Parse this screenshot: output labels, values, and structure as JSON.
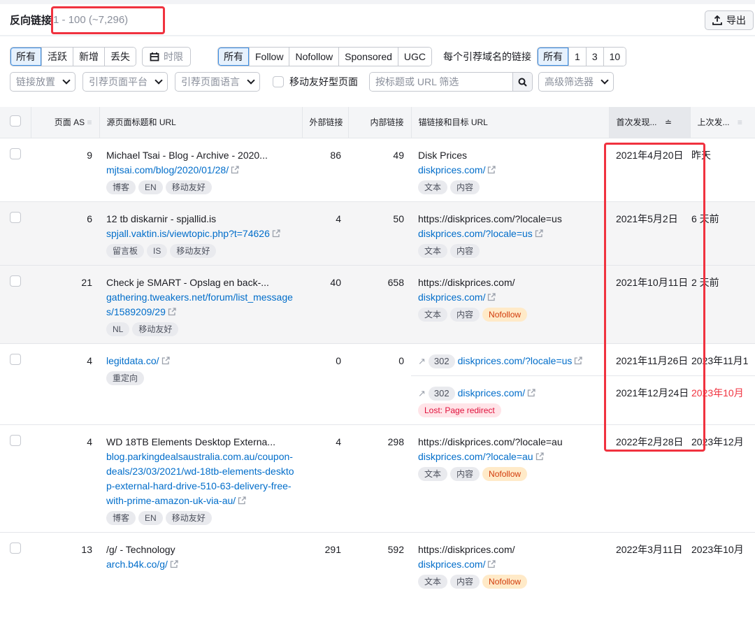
{
  "header": {
    "title": "反向链接",
    "count": "1 - 100 (~7,296)",
    "export_label": "导出",
    "export_icon": "upload-icon"
  },
  "filters": {
    "status_options": [
      "所有",
      "活跃",
      "新增",
      "丢失"
    ],
    "status_selected": "所有",
    "period_label": "时限",
    "period_icon": "calendar-icon",
    "type_options": [
      "所有",
      "Follow",
      "Nofollow",
      "Sponsored",
      "UGC"
    ],
    "type_selected": "所有",
    "per_domain_label": "每个引荐域名的链接",
    "per_domain_options": [
      "所有",
      "1",
      "3",
      "10"
    ],
    "per_domain_selected": "所有",
    "dropdowns": [
      "链接放置",
      "引荐页面平台",
      "引荐页面语言"
    ],
    "mobile_friendly_label": "移动友好型页面",
    "search_placeholder": "按标题或 URL 筛选",
    "advanced_label": "高级筛选器"
  },
  "table": {
    "columns": [
      "页面 AS",
      "源页面标题和 URL",
      "外部链接",
      "内部链接",
      "锚链接和目标 URL",
      "首次发现...",
      "上次发..."
    ],
    "rows": [
      {
        "as": "9",
        "title": "Michael Tsai - Blog - Archive - 2020...",
        "url": "mjtsai.com/blog/2020/01/28/",
        "tags": [
          "博客",
          "EN",
          "移动友好"
        ],
        "external": "86",
        "internal": "49",
        "links": [
          {
            "anchor": "Disk Prices",
            "target": "diskprices.com/",
            "tags": [
              "文本",
              "内容"
            ],
            "first_seen": "2021年4月20日",
            "last_seen": "昨天"
          }
        ]
      },
      {
        "as": "6",
        "title": "12 tb diskarnir - spjallid.is",
        "url": "spjall.vaktin.is/viewtopic.php?t=74626",
        "tags": [
          "留言板",
          "IS",
          "移动友好"
        ],
        "external": "4",
        "internal": "50",
        "links": [
          {
            "anchor": "https://diskprices.com/?locale=us",
            "target": "diskprices.com/?locale=us",
            "tags": [
              "文本",
              "内容"
            ],
            "first_seen": "2021年5月2日",
            "last_seen": "6 天前"
          }
        ]
      },
      {
        "as": "21",
        "title": "Check je SMART - Opslag en back-...",
        "url": "gathering.tweakers.net/forum/list_messages/1589209/29",
        "tags": [
          "NL",
          "移动友好"
        ],
        "external": "40",
        "internal": "658",
        "links": [
          {
            "anchor": "https://diskprices.com/",
            "target": "diskprices.com/",
            "tags": [
              "文本",
              "内容",
              "Nofollow"
            ],
            "first_seen": "2021年10月11日",
            "last_seen": "2 天前"
          }
        ]
      },
      {
        "as": "4",
        "title": "",
        "url": "legitdata.co/",
        "tags": [
          "重定向"
        ],
        "external": "0",
        "internal": "0",
        "links": [
          {
            "redirect_code": "302",
            "target": "diskprices.com/?locale=us",
            "tags": [],
            "first_seen": "2021年11月26日",
            "last_seen": "2023年11月1"
          },
          {
            "redirect_code": "302",
            "target": "diskprices.com/",
            "tags": [
              "Lost: Page redirect"
            ],
            "first_seen": "2021年12月24日",
            "last_seen": "2023年10月",
            "last_seen_lost": true
          }
        ]
      },
      {
        "as": "4",
        "title": "WD 18TB Elements Desktop Externa...",
        "url": "blog.parkingdealsaustralia.com.au/coupon-deals/23/03/2021/wd-18tb-elements-desktop-external-hard-drive-510-63-delivery-free-with-prime-amazon-uk-via-au/",
        "tags": [
          "博客",
          "EN",
          "移动友好"
        ],
        "external": "4",
        "internal": "298",
        "links": [
          {
            "anchor": "https://diskprices.com/?locale=au",
            "target": "diskprices.com/?locale=au",
            "tags": [
              "文本",
              "内容",
              "Nofollow"
            ],
            "first_seen": "2022年2月28日",
            "last_seen": "2023年12月"
          }
        ]
      },
      {
        "as": "13",
        "title": "/g/ - Technology",
        "url": "arch.b4k.co/g/",
        "tags": [],
        "external": "291",
        "internal": "592",
        "links": [
          {
            "anchor": "https://diskprices.com/",
            "target": "diskprices.com/",
            "tags": [
              "文本",
              "内容",
              "Nofollow"
            ],
            "first_seen": "2022年3月11日",
            "last_seen": "2023年10月"
          }
        ]
      }
    ]
  },
  "colors": {
    "link": "#006dca",
    "highlight_box": "#f0323f",
    "nofollow_text": "#d13a0a",
    "lost_text": "#e0113c",
    "selected_bg": "#e6f1fd"
  }
}
